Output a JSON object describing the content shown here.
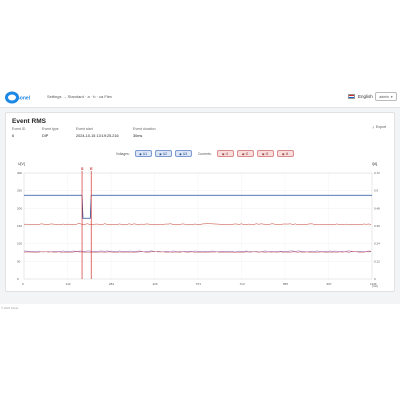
{
  "header": {
    "breadcrumb": "Settings → Standard · a · b · ca Flex",
    "language": "English",
    "user": "admin"
  },
  "card": {
    "title": "Event RMS",
    "export_label": "Export",
    "meta": [
      {
        "label": "Event ID",
        "value": "6"
      },
      {
        "label": "Event type",
        "value": "DIP"
      },
      {
        "label": "Event start",
        "value": "2024-10-15 13:19:25.216"
      },
      {
        "label": "Event duration",
        "value": "30ms"
      }
    ],
    "voltages_label": "Voltages:",
    "voltages": [
      "U1",
      "U2",
      "U3"
    ],
    "currents_label": "Currents:",
    "currents": [
      "I1",
      "I2",
      "I3",
      "I4"
    ]
  },
  "footer": "© 2024 Sonel",
  "chart_data": {
    "type": "line",
    "y_left_label": "U[V]",
    "y_right_label": "I[A]",
    "x_unit": "[ms]",
    "x_ticks": [
      "0",
      "142",
      "284",
      "426",
      "571",
      "713",
      "855",
      "997",
      "1139"
    ],
    "y_left_ticks": [
      "300",
      "250",
      "200",
      "150",
      "100",
      "50",
      "0"
    ],
    "y_right_ticks": [
      "0.72",
      "0.6",
      "0.48",
      "0.36",
      "0.24",
      "0.12",
      "0"
    ],
    "xlim": [
      0,
      1139
    ],
    "ylim_left": [
      0,
      300
    ],
    "markers": [
      {
        "label": "S",
        "x": 190
      },
      {
        "label": "E",
        "x": 220
      }
    ],
    "voltage_series": {
      "name": "U",
      "color": "#1f4e9b",
      "baseline": 237,
      "dip_min": 172,
      "dip_start": 190,
      "dip_end": 220
    },
    "current_series": [
      {
        "name": "I1",
        "color": "#c0392b",
        "level": 155
      },
      {
        "name": "I2",
        "color": "#7a3b8f",
        "level": 78
      },
      {
        "name": "I3",
        "color": "#d16a6a",
        "level": 76
      }
    ],
    "grid": true
  }
}
